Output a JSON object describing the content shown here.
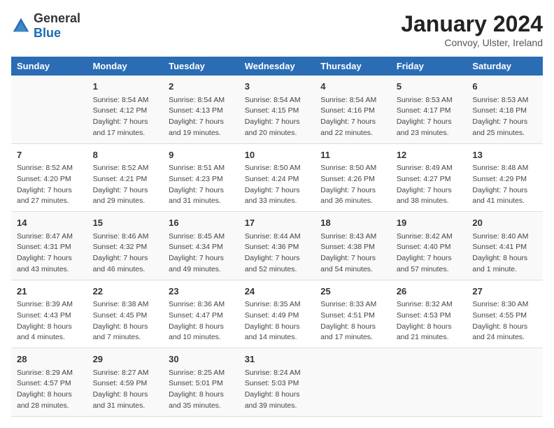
{
  "header": {
    "logo_general": "General",
    "logo_blue": "Blue",
    "main_title": "January 2024",
    "subtitle": "Convoy, Ulster, Ireland"
  },
  "days_of_week": [
    "Sunday",
    "Monday",
    "Tuesday",
    "Wednesday",
    "Thursday",
    "Friday",
    "Saturday"
  ],
  "weeks": [
    [
      {
        "day": "",
        "info": []
      },
      {
        "day": "1",
        "info": [
          "Sunrise: 8:54 AM",
          "Sunset: 4:12 PM",
          "Daylight: 7 hours",
          "and 17 minutes."
        ]
      },
      {
        "day": "2",
        "info": [
          "Sunrise: 8:54 AM",
          "Sunset: 4:13 PM",
          "Daylight: 7 hours",
          "and 19 minutes."
        ]
      },
      {
        "day": "3",
        "info": [
          "Sunrise: 8:54 AM",
          "Sunset: 4:15 PM",
          "Daylight: 7 hours",
          "and 20 minutes."
        ]
      },
      {
        "day": "4",
        "info": [
          "Sunrise: 8:54 AM",
          "Sunset: 4:16 PM",
          "Daylight: 7 hours",
          "and 22 minutes."
        ]
      },
      {
        "day": "5",
        "info": [
          "Sunrise: 8:53 AM",
          "Sunset: 4:17 PM",
          "Daylight: 7 hours",
          "and 23 minutes."
        ]
      },
      {
        "day": "6",
        "info": [
          "Sunrise: 8:53 AM",
          "Sunset: 4:18 PM",
          "Daylight: 7 hours",
          "and 25 minutes."
        ]
      }
    ],
    [
      {
        "day": "7",
        "info": [
          "Sunrise: 8:52 AM",
          "Sunset: 4:20 PM",
          "Daylight: 7 hours",
          "and 27 minutes."
        ]
      },
      {
        "day": "8",
        "info": [
          "Sunrise: 8:52 AM",
          "Sunset: 4:21 PM",
          "Daylight: 7 hours",
          "and 29 minutes."
        ]
      },
      {
        "day": "9",
        "info": [
          "Sunrise: 8:51 AM",
          "Sunset: 4:23 PM",
          "Daylight: 7 hours",
          "and 31 minutes."
        ]
      },
      {
        "day": "10",
        "info": [
          "Sunrise: 8:50 AM",
          "Sunset: 4:24 PM",
          "Daylight: 7 hours",
          "and 33 minutes."
        ]
      },
      {
        "day": "11",
        "info": [
          "Sunrise: 8:50 AM",
          "Sunset: 4:26 PM",
          "Daylight: 7 hours",
          "and 36 minutes."
        ]
      },
      {
        "day": "12",
        "info": [
          "Sunrise: 8:49 AM",
          "Sunset: 4:27 PM",
          "Daylight: 7 hours",
          "and 38 minutes."
        ]
      },
      {
        "day": "13",
        "info": [
          "Sunrise: 8:48 AM",
          "Sunset: 4:29 PM",
          "Daylight: 7 hours",
          "and 41 minutes."
        ]
      }
    ],
    [
      {
        "day": "14",
        "info": [
          "Sunrise: 8:47 AM",
          "Sunset: 4:31 PM",
          "Daylight: 7 hours",
          "and 43 minutes."
        ]
      },
      {
        "day": "15",
        "info": [
          "Sunrise: 8:46 AM",
          "Sunset: 4:32 PM",
          "Daylight: 7 hours",
          "and 46 minutes."
        ]
      },
      {
        "day": "16",
        "info": [
          "Sunrise: 8:45 AM",
          "Sunset: 4:34 PM",
          "Daylight: 7 hours",
          "and 49 minutes."
        ]
      },
      {
        "day": "17",
        "info": [
          "Sunrise: 8:44 AM",
          "Sunset: 4:36 PM",
          "Daylight: 7 hours",
          "and 52 minutes."
        ]
      },
      {
        "day": "18",
        "info": [
          "Sunrise: 8:43 AM",
          "Sunset: 4:38 PM",
          "Daylight: 7 hours",
          "and 54 minutes."
        ]
      },
      {
        "day": "19",
        "info": [
          "Sunrise: 8:42 AM",
          "Sunset: 4:40 PM",
          "Daylight: 7 hours",
          "and 57 minutes."
        ]
      },
      {
        "day": "20",
        "info": [
          "Sunrise: 8:40 AM",
          "Sunset: 4:41 PM",
          "Daylight: 8 hours",
          "and 1 minute."
        ]
      }
    ],
    [
      {
        "day": "21",
        "info": [
          "Sunrise: 8:39 AM",
          "Sunset: 4:43 PM",
          "Daylight: 8 hours",
          "and 4 minutes."
        ]
      },
      {
        "day": "22",
        "info": [
          "Sunrise: 8:38 AM",
          "Sunset: 4:45 PM",
          "Daylight: 8 hours",
          "and 7 minutes."
        ]
      },
      {
        "day": "23",
        "info": [
          "Sunrise: 8:36 AM",
          "Sunset: 4:47 PM",
          "Daylight: 8 hours",
          "and 10 minutes."
        ]
      },
      {
        "day": "24",
        "info": [
          "Sunrise: 8:35 AM",
          "Sunset: 4:49 PM",
          "Daylight: 8 hours",
          "and 14 minutes."
        ]
      },
      {
        "day": "25",
        "info": [
          "Sunrise: 8:33 AM",
          "Sunset: 4:51 PM",
          "Daylight: 8 hours",
          "and 17 minutes."
        ]
      },
      {
        "day": "26",
        "info": [
          "Sunrise: 8:32 AM",
          "Sunset: 4:53 PM",
          "Daylight: 8 hours",
          "and 21 minutes."
        ]
      },
      {
        "day": "27",
        "info": [
          "Sunrise: 8:30 AM",
          "Sunset: 4:55 PM",
          "Daylight: 8 hours",
          "and 24 minutes."
        ]
      }
    ],
    [
      {
        "day": "28",
        "info": [
          "Sunrise: 8:29 AM",
          "Sunset: 4:57 PM",
          "Daylight: 8 hours",
          "and 28 minutes."
        ]
      },
      {
        "day": "29",
        "info": [
          "Sunrise: 8:27 AM",
          "Sunset: 4:59 PM",
          "Daylight: 8 hours",
          "and 31 minutes."
        ]
      },
      {
        "day": "30",
        "info": [
          "Sunrise: 8:25 AM",
          "Sunset: 5:01 PM",
          "Daylight: 8 hours",
          "and 35 minutes."
        ]
      },
      {
        "day": "31",
        "info": [
          "Sunrise: 8:24 AM",
          "Sunset: 5:03 PM",
          "Daylight: 8 hours",
          "and 39 minutes."
        ]
      },
      {
        "day": "",
        "info": []
      },
      {
        "day": "",
        "info": []
      },
      {
        "day": "",
        "info": []
      }
    ]
  ]
}
